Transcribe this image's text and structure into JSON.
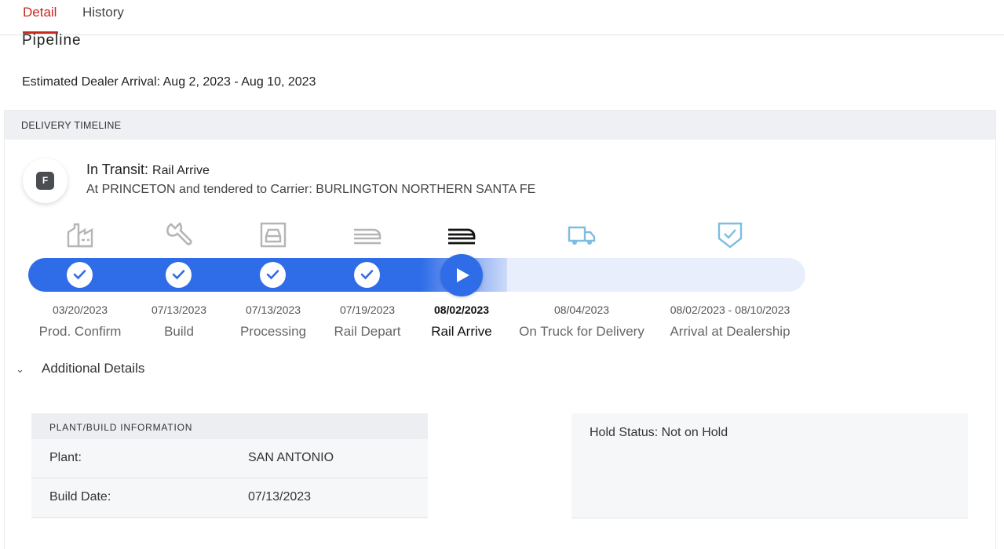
{
  "tabs": [
    {
      "label": "Detail",
      "active": true
    },
    {
      "label": "History",
      "active": false
    }
  ],
  "pipeline_title": "Pipeline",
  "estimated_arrival": "Estimated Dealer Arrival: Aug 2, 2023 - Aug 10, 2023",
  "timeline": {
    "header": "DELIVERY TIMELINE",
    "badge_letter": "F",
    "status_prefix": "In Transit:",
    "status_value": "Rail Arrive",
    "status_detail": "At PRINCETON and tendered to Carrier: BURLINGTON NORTHERN SANTA FE",
    "steps": [
      {
        "date": "03/20/2023",
        "label": "Prod. Confirm",
        "icon": "factory-icon",
        "state": "done"
      },
      {
        "date": "07/13/2023",
        "label": "Build",
        "icon": "wrench-icon",
        "state": "done"
      },
      {
        "date": "07/13/2023",
        "label": "Processing",
        "icon": "car-garage-icon",
        "state": "done"
      },
      {
        "date": "07/19/2023",
        "label": "Rail Depart",
        "icon": "train-icon",
        "state": "done"
      },
      {
        "date": "08/02/2023",
        "label": "Rail Arrive",
        "icon": "train-icon",
        "state": "current"
      },
      {
        "date": "08/04/2023",
        "label": "On Truck for Delivery",
        "icon": "truck-icon",
        "state": "upcoming"
      },
      {
        "date": "08/02/2023 - 08/10/2023",
        "label": "Arrival at Dealership",
        "icon": "shield-check-icon",
        "state": "upcoming"
      }
    ],
    "colors": {
      "progress": "#2f6ce8",
      "track": "#e8eefc",
      "upcoming_icon": "#7fbde0",
      "done_icon": "#b5b5b5"
    }
  },
  "additional_details": {
    "title": "Additional Details",
    "plant_info": {
      "header": "PLANT/BUILD INFORMATION",
      "rows": [
        {
          "key": "Plant:",
          "value": "SAN ANTONIO"
        },
        {
          "key": "Build Date:",
          "value": "07/13/2023"
        }
      ]
    },
    "hold_status": "Hold Status: Not on Hold"
  }
}
